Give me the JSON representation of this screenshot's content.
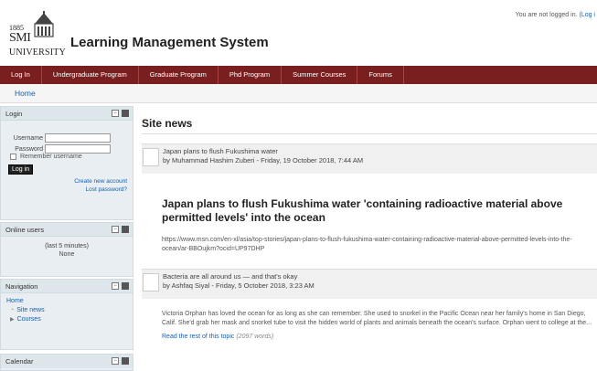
{
  "login_status": {
    "text": "You are not logged in. (",
    "link": "Log i"
  },
  "logo": {
    "year": "1885",
    "name": "SMI",
    "university": "UNIVERSITY"
  },
  "site_title": "Learning Management System",
  "navbar": {
    "items": [
      "Log In",
      "Undergraduate Program",
      "Graduate Program",
      "Phd Program",
      "Summer Courses",
      "Forums"
    ]
  },
  "breadcrumb": "Home",
  "login_block": {
    "title": "Login",
    "username_label": "Username",
    "password_label": "Password",
    "remember_label": "Remember username",
    "button_label": "Log in",
    "create_account": "Create new account",
    "lost_password": "Lost password?"
  },
  "online_block": {
    "title": "Online users",
    "period": "(last 5 minutes)",
    "value": "None"
  },
  "navigation_block": {
    "title": "Navigation",
    "home": "Home",
    "site_news": "Site news",
    "courses": "Courses"
  },
  "calendar_block": {
    "title": "Calendar"
  },
  "main": {
    "title": "Site news",
    "posts": [
      {
        "subject": "Japan plans to flush Fukushima water",
        "byline": "by Muhammad Hashim Zuberi - Friday, 19 October 2018, 7:44 AM",
        "heading": "Japan plans to flush Fukushima water 'containing radioactive material above permitted levels' into the ocean",
        "text": "https://www.msn.com/en-xl/asia/top-stories/japan-plans-to-flush-fukushima-water-containing-radioactive-material-above-permitted-levels-into-the-ocean/ar-BBOujkm?ocid=UP97DHP"
      },
      {
        "subject": "Bacteria are all around us — and that's okay",
        "byline": "by Ashfaq Siyal - Friday, 5 October 2018, 3:23 AM",
        "text": "Victoria Orphan has loved the ocean for as long as she can remember. She used to snorkel in the Pacific Ocean near her family's home in San Diego, Calif. She'd grab her mask and snorkel tube to visit the hidden world of plants and animals beneath the ocean's surface. Orphan went to college at the...",
        "readmore": "Read the rest of this topic",
        "words": "(2097 words)"
      }
    ]
  }
}
